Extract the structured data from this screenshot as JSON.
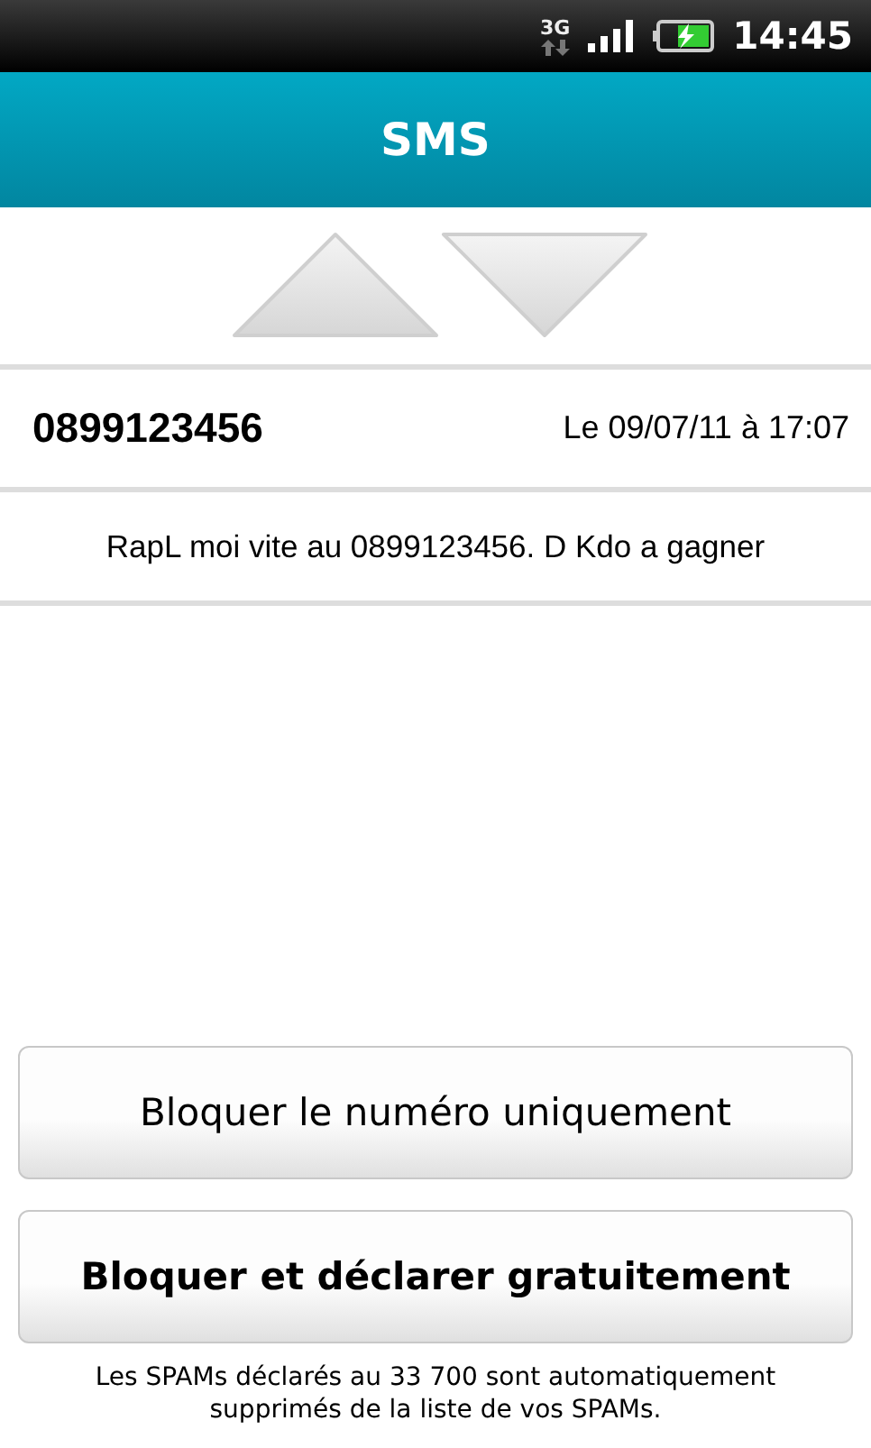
{
  "status_bar": {
    "network": "3G",
    "time": "14:45"
  },
  "header": {
    "title": "SMS"
  },
  "message": {
    "sender": "0899123456",
    "date": "Le 09/07/11 à 17:07",
    "body": "RapL moi vite au 0899123456. D Kdo a gagner"
  },
  "buttons": [
    {
      "label": "Bloquer le numéro uniquement",
      "kind": "secondary"
    },
    {
      "label": "Bloquer et déclarer gratuitement",
      "kind": "primary"
    }
  ],
  "note": "Les SPAMs déclarés au 33 700 sont automatiquement supprimés de la liste de vos SPAMs."
}
